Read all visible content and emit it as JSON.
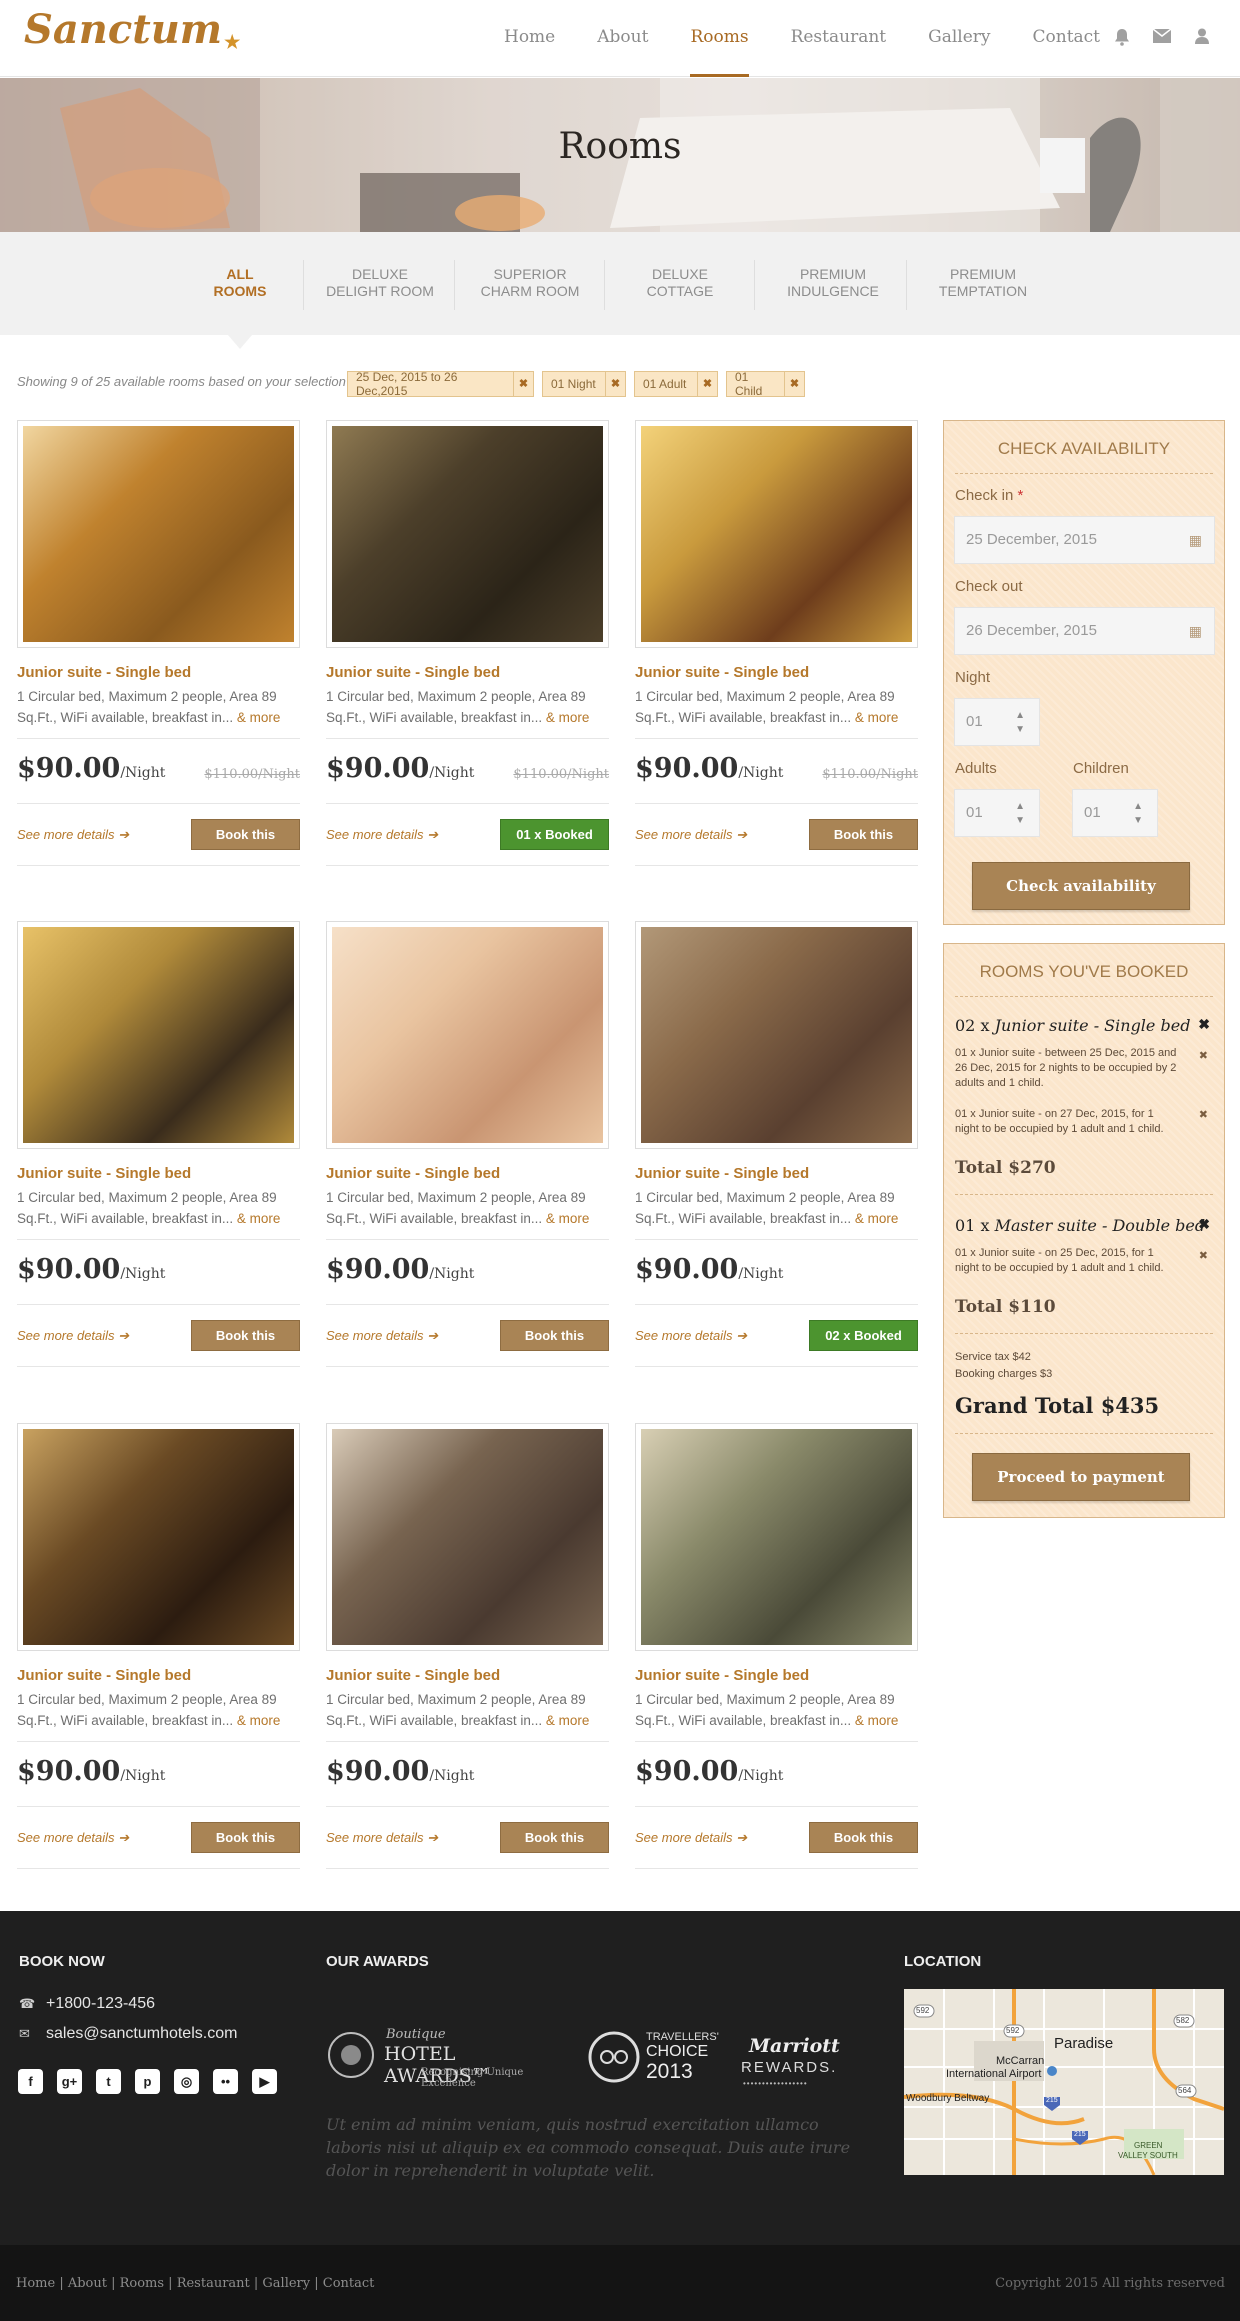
{
  "brand": {
    "name": "Sanctum",
    "color": "#b5782b"
  },
  "nav": {
    "items": [
      "Home",
      "About",
      "Rooms",
      "Restaurant",
      "Gallery",
      "Contact"
    ],
    "active": "Rooms",
    "icons": [
      "bell-icon",
      "envelope-icon",
      "user-icon"
    ]
  },
  "banner": {
    "title": "Rooms"
  },
  "tabs": [
    {
      "line1": "ALL",
      "line2": "ROOMS"
    },
    {
      "line1": "DELUXE",
      "line2": "DELIGHT ROOM"
    },
    {
      "line1": "SUPERIOR",
      "line2": "CHARM ROOM"
    },
    {
      "line1": "DELUXE",
      "line2": "COTTAGE"
    },
    {
      "line1": "PREMIUM",
      "line2": "INDULGENCE"
    },
    {
      "line1": "PREMIUM",
      "line2": "TEMPTATION"
    }
  ],
  "filters": {
    "showing": "Showing 9 of 25 available rooms based on your selection",
    "chips": [
      "25 Dec, 2015 to 26 Dec,2015",
      "01 Night",
      "01 Adult",
      "01 Child"
    ]
  },
  "rooms": [
    {
      "title": "Junior suite - Single bed",
      "desc": "1 Circular bed, Maximum 2 people, Area 89 Sq.Ft., WiFi available, breakfast in...",
      "more": "& more",
      "price": "$90.00",
      "per": "/Night",
      "old_price": "$110.00/Night",
      "details": "See more details",
      "button": "Book this",
      "booked": false
    },
    {
      "title": "Junior suite - Single bed",
      "desc": "1 Circular bed, Maximum 2 people, Area 89 Sq.Ft., WiFi available, breakfast in...",
      "more": "& more",
      "price": "$90.00",
      "per": "/Night",
      "old_price": "$110.00/Night",
      "details": "See more details",
      "button": "01 x Booked",
      "booked": true
    },
    {
      "title": "Junior suite - Single bed",
      "desc": "1 Circular bed, Maximum 2 people, Area 89 Sq.Ft., WiFi available, breakfast in...",
      "more": "& more",
      "price": "$90.00",
      "per": "/Night",
      "old_price": "$110.00/Night",
      "details": "See more details",
      "button": "Book this",
      "booked": false
    },
    {
      "title": "Junior suite - Single bed",
      "desc": "1 Circular bed, Maximum 2 people, Area 89 Sq.Ft., WiFi available, breakfast in...",
      "more": "& more",
      "price": "$90.00",
      "per": "/Night",
      "old_price": "",
      "details": "See more details",
      "button": "Book this",
      "booked": false
    },
    {
      "title": "Junior suite - Single bed",
      "desc": "1 Circular bed, Maximum 2 people, Area 89 Sq.Ft., WiFi available, breakfast in...",
      "more": "& more",
      "price": "$90.00",
      "per": "/Night",
      "old_price": "",
      "details": "See more details",
      "button": "Book this",
      "booked": false
    },
    {
      "title": "Junior suite - Single bed",
      "desc": "1 Circular bed, Maximum 2 people, Area 89 Sq.Ft., WiFi available, breakfast in...",
      "more": "& more",
      "price": "$90.00",
      "per": "/Night",
      "old_price": "",
      "details": "See more details",
      "button": "02 x Booked",
      "booked": true
    },
    {
      "title": "Junior suite - Single bed",
      "desc": "1 Circular bed, Maximum 2 people, Area 89 Sq.Ft., WiFi available, breakfast in...",
      "more": "& more",
      "price": "$90.00",
      "per": "/Night",
      "old_price": "",
      "details": "See more details",
      "button": "Book this",
      "booked": false
    },
    {
      "title": "Junior suite - Single bed",
      "desc": "1 Circular bed, Maximum 2 people, Area 89 Sq.Ft., WiFi available, breakfast in...",
      "more": "& more",
      "price": "$90.00",
      "per": "/Night",
      "old_price": "",
      "details": "See more details",
      "button": "Book this",
      "booked": false
    },
    {
      "title": "Junior suite - Single bed",
      "desc": "1 Circular bed, Maximum 2 people, Area 89 Sq.Ft., WiFi available, breakfast in...",
      "more": "& more",
      "price": "$90.00",
      "per": "/Night",
      "old_price": "",
      "details": "See more details",
      "button": "Book this",
      "booked": false
    }
  ],
  "availability": {
    "title": "CHECK AVAILABILITY",
    "checkin_label": "Check in",
    "checkin_value": "25 December, 2015",
    "checkout_label": "Check out",
    "checkout_value": "26 December, 2015",
    "night_label": "Night",
    "night_value": "01",
    "adults_label": "Adults",
    "adults_value": "01",
    "children_label": "Children",
    "children_value": "01",
    "button": "Check availability"
  },
  "booked": {
    "title": "ROOMS YOU'VE BOOKED",
    "groups": [
      {
        "qty": "02 x",
        "name": "Junior suite - Single bed",
        "lines": [
          "01 x Junior suite - between 25 Dec, 2015 and 26 Dec, 2015 for 2 nights to be occupied by 2 adults and 1 child.",
          "01 x Junior suite - on 27 Dec, 2015, for 1 night to be occupied by 1 adult and 1 child."
        ],
        "total": "Total $270"
      },
      {
        "qty": "01 x",
        "name": "Master suite - Double bed",
        "lines": [
          "01 x Junior suite - on 25 Dec, 2015, for 1 night to be occupied by 1 adult and 1 child."
        ],
        "total": "Total $110"
      }
    ],
    "service_tax": "Service tax $42",
    "booking_charges": "Booking charges $3",
    "grand_total": "Grand Total $435",
    "button": "Proceed to payment"
  },
  "footer": {
    "book_now": "BOOK NOW",
    "phone": "+1800-123-456",
    "email": "sales@sanctumhotels.com",
    "social": [
      "facebook-icon",
      "google-plus-icon",
      "twitter-icon",
      "pinterest-icon",
      "instagram-icon",
      "flickr-icon",
      "youtube-icon"
    ],
    "awards_title": "OUR AWARDS",
    "award1": {
      "script": "Boutique",
      "main": "HOTEL AWARDS™",
      "sub": "Recognising Unique Excellence"
    },
    "award2": {
      "line1": "TRAVELLERS'",
      "line2": "CHOICE",
      "year": "2013"
    },
    "award3": {
      "line1": "Marriott",
      "line2": "REWARDS."
    },
    "quote": "Ut enim ad minim veniam, quis nostrud exercitation ullamco laboris nisi ut aliquip ex ea commodo consequat. Duis aute irure dolor in reprehenderit in voluptate velit.",
    "location_title": "LOCATION",
    "map_labels": {
      "city": "Paradise",
      "airport1": "McCarran",
      "airport2": "International Airport",
      "road": "Woodbury Beltway",
      "area1": "GREEN",
      "area2": "VALLEY SOUTH",
      "r592a": "592",
      "r592b": "592",
      "r582": "582",
      "r564": "564",
      "r215a": "215",
      "r215b": "215"
    },
    "links": "Home | About | Rooms | Restaurant | Gallery | Contact",
    "copyright": "Copyright 2015 All rights reserved"
  }
}
